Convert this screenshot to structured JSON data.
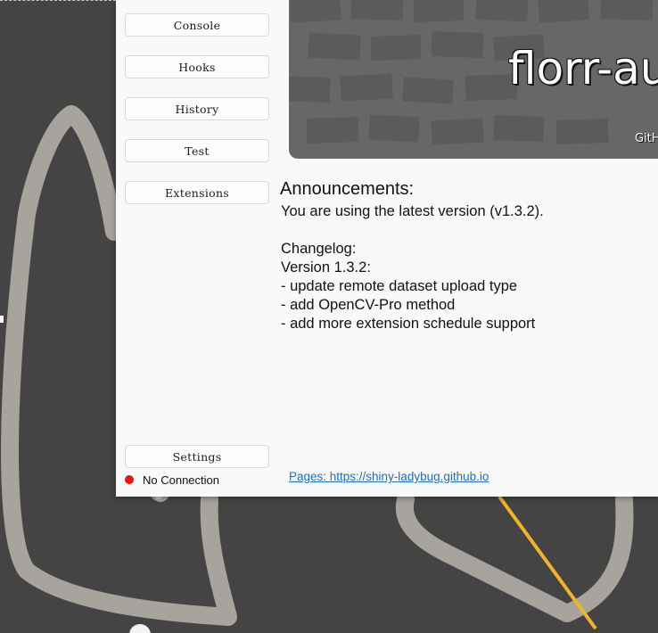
{
  "colors": {
    "desktop_bg": "#444444",
    "stroke": "#a8a39d",
    "line": "#f0b429",
    "window_bg": "#f9f9f9",
    "banner_bg": "#676767",
    "status_disconnected": "#ee1111",
    "link": "#1f6fbd"
  },
  "nav": {
    "console": "Console",
    "hooks": "Hooks",
    "history": "History",
    "test": "Test",
    "extensions": "Extensions",
    "settings": "Settings"
  },
  "banner": {
    "title": "florr-au",
    "subtitle": "GitH"
  },
  "announcements": {
    "title": "Announcements:",
    "body": "You are using the latest version (v1.3.2).\n\nChangelog:\nVersion 1.3.2:\n- update remote dataset upload type\n- add OpenCV-Pro method\n- add more extension schedule support"
  },
  "footer": {
    "pages_link": "Pages: https://shiny-ladybug.github.io"
  },
  "status": {
    "icon": "status-dot-icon",
    "text": "No Connection"
  }
}
